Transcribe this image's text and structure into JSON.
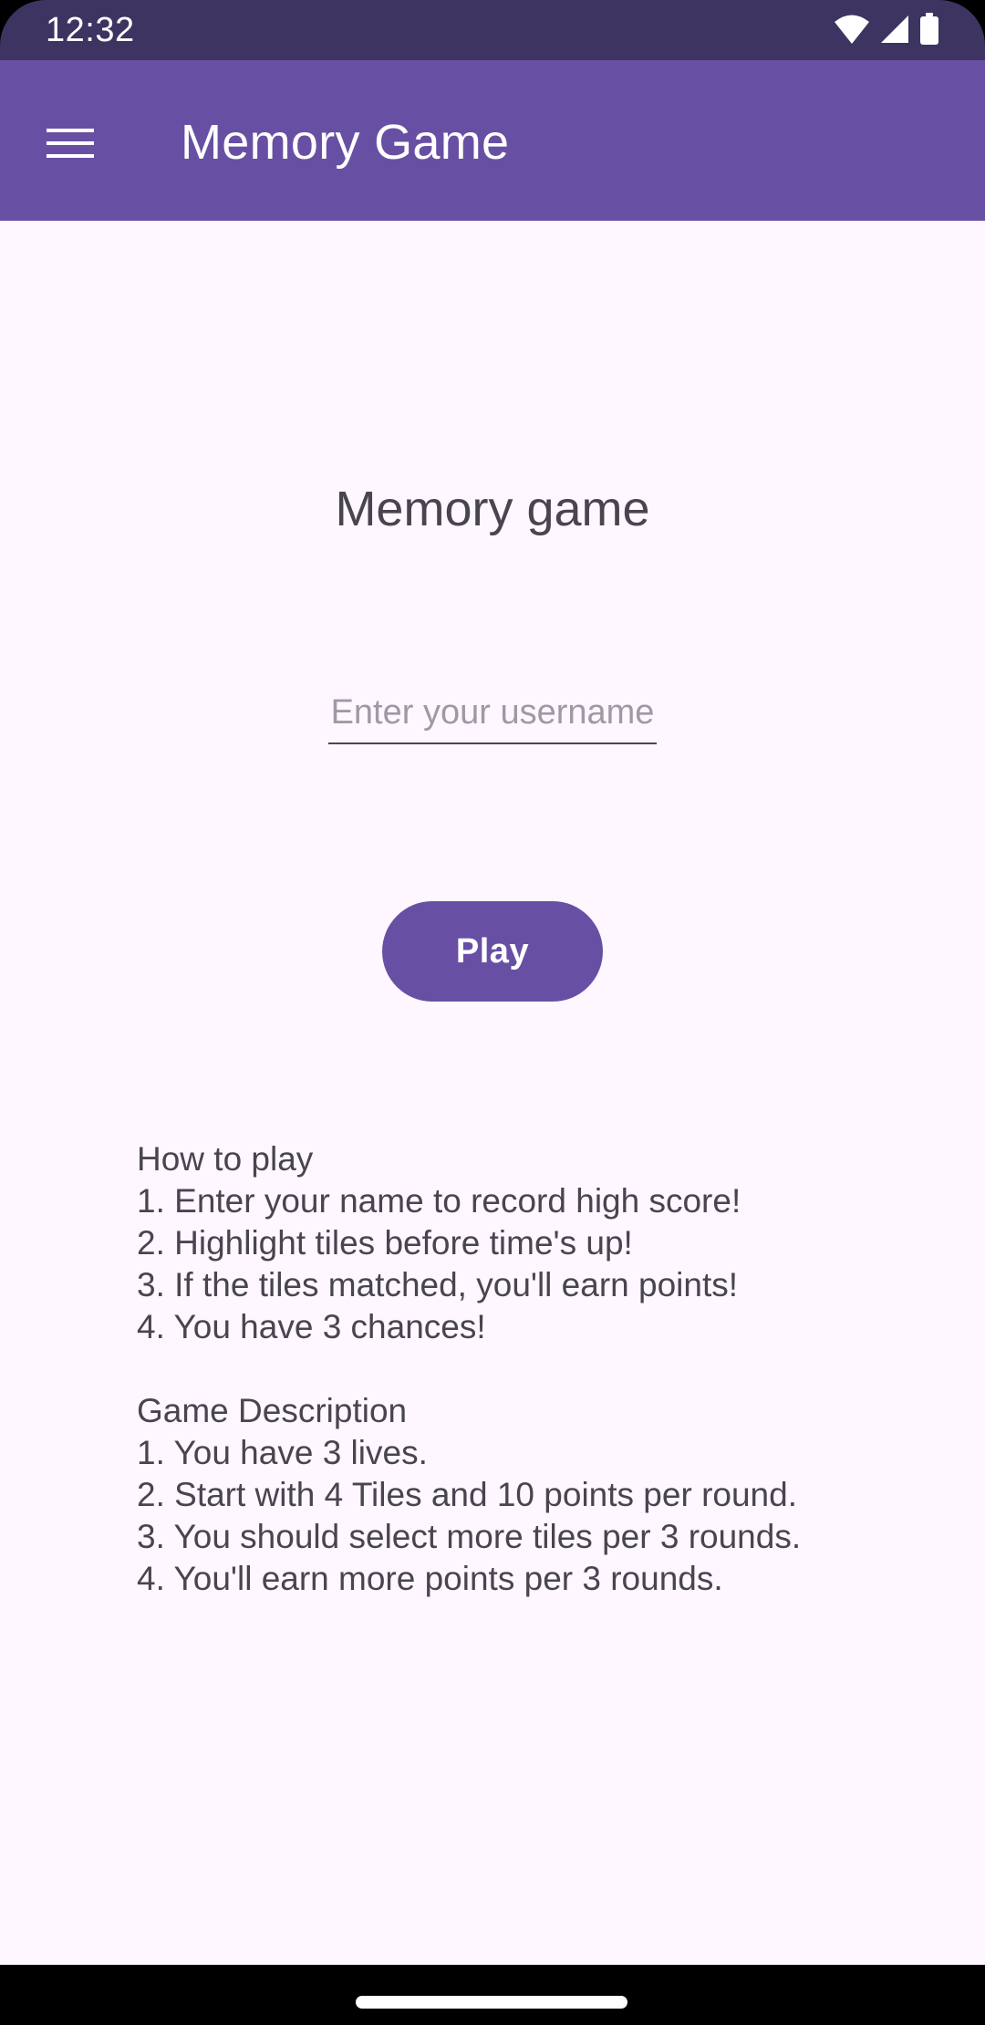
{
  "status_bar": {
    "time": "12:32",
    "icons": [
      "wifi-icon",
      "cellular-signal-icon",
      "battery-icon"
    ]
  },
  "app_bar": {
    "menu_icon": "menu-icon",
    "title": "Memory Game"
  },
  "main": {
    "heading": "Memory game",
    "username_input": {
      "placeholder": "Enter your username",
      "value": ""
    },
    "play_button": "Play",
    "how_to_play": {
      "title": "How to play",
      "steps": [
        "1. Enter your name to record high score!",
        "2. Highlight tiles before time's up!",
        "3. If the tiles matched, you'll earn points!",
        "4. You have 3 chances!"
      ]
    },
    "game_description": {
      "title": "Game Description",
      "items": [
        "1. You have 3 lives.",
        "2. Start with 4 Tiles and 10 points per round.",
        "3. You should select more tiles per 3 rounds.",
        "4. You'll earn more points per 3 rounds."
      ]
    }
  },
  "colors": {
    "status_bar": "#3d3461",
    "app_bar": "#6750a4",
    "background": "#fef7ff",
    "text": "#49454f",
    "button": "#6750a4"
  }
}
